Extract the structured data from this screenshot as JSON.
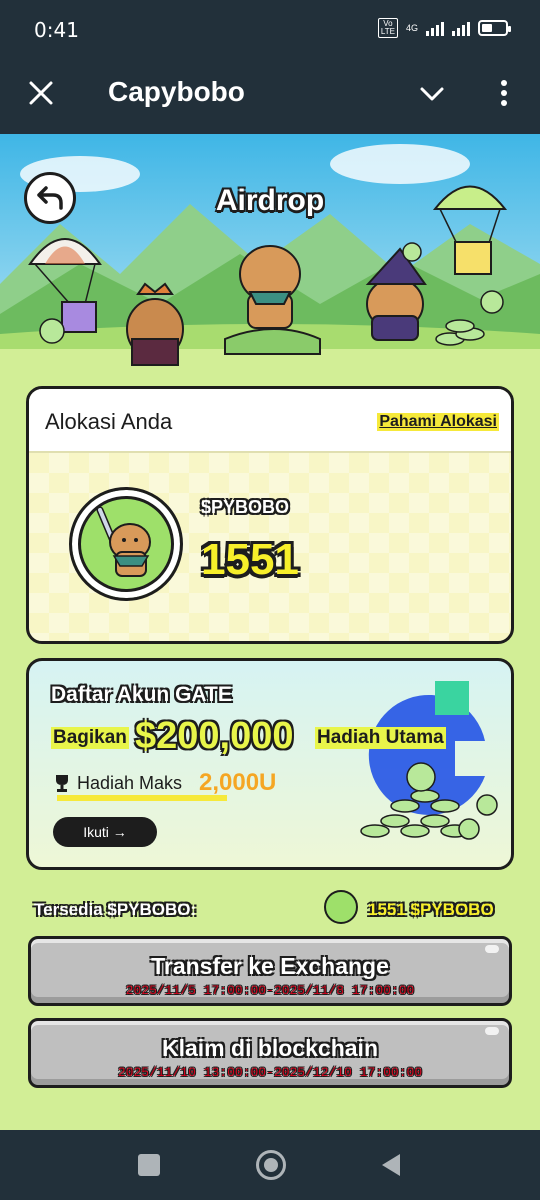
{
  "status_bar": {
    "time": "0:41",
    "network": "4G",
    "volte": "Vo LTE"
  },
  "title_bar": {
    "title": "Capybobo",
    "close_icon": "close-icon",
    "chevron_icon": "chevron-down-icon",
    "more_icon": "more-vertical-icon"
  },
  "hero": {
    "title": "Airdrop",
    "back_icon": "back-arrow-icon"
  },
  "allocation": {
    "title": "Alokasi Anda",
    "link": "Pahami Alokasi",
    "token_name": "$PYBOBO",
    "amount": "1551"
  },
  "gate_banner": {
    "title": "Daftar Akun GATE",
    "share_label": "Bagikan",
    "prize_amount": "$200,000",
    "prize_label": "Hadiah Utama",
    "max_label": "Hadiah Maks",
    "max_value": "2,000U",
    "follow_button": "Ikuti →"
  },
  "available": {
    "label": "Tersedia $PYBOBO:",
    "value": "1551 $PYBOBO"
  },
  "actions": {
    "transfer": {
      "label": "Transfer ke Exchange",
      "time": "2025/11/5 17:00:00-2025/11/8 17:00:00"
    },
    "claim": {
      "label": "Klaim di blockchain",
      "time": "2025/11/10 13:00:00-2025/12/10 17:00:00"
    }
  },
  "colors": {
    "background": "#d2ee96",
    "header": "#22303a",
    "accent_yellow": "#f7ef2a",
    "timestamp_red": "#d0021b",
    "gate_blue": "#2354e6"
  }
}
